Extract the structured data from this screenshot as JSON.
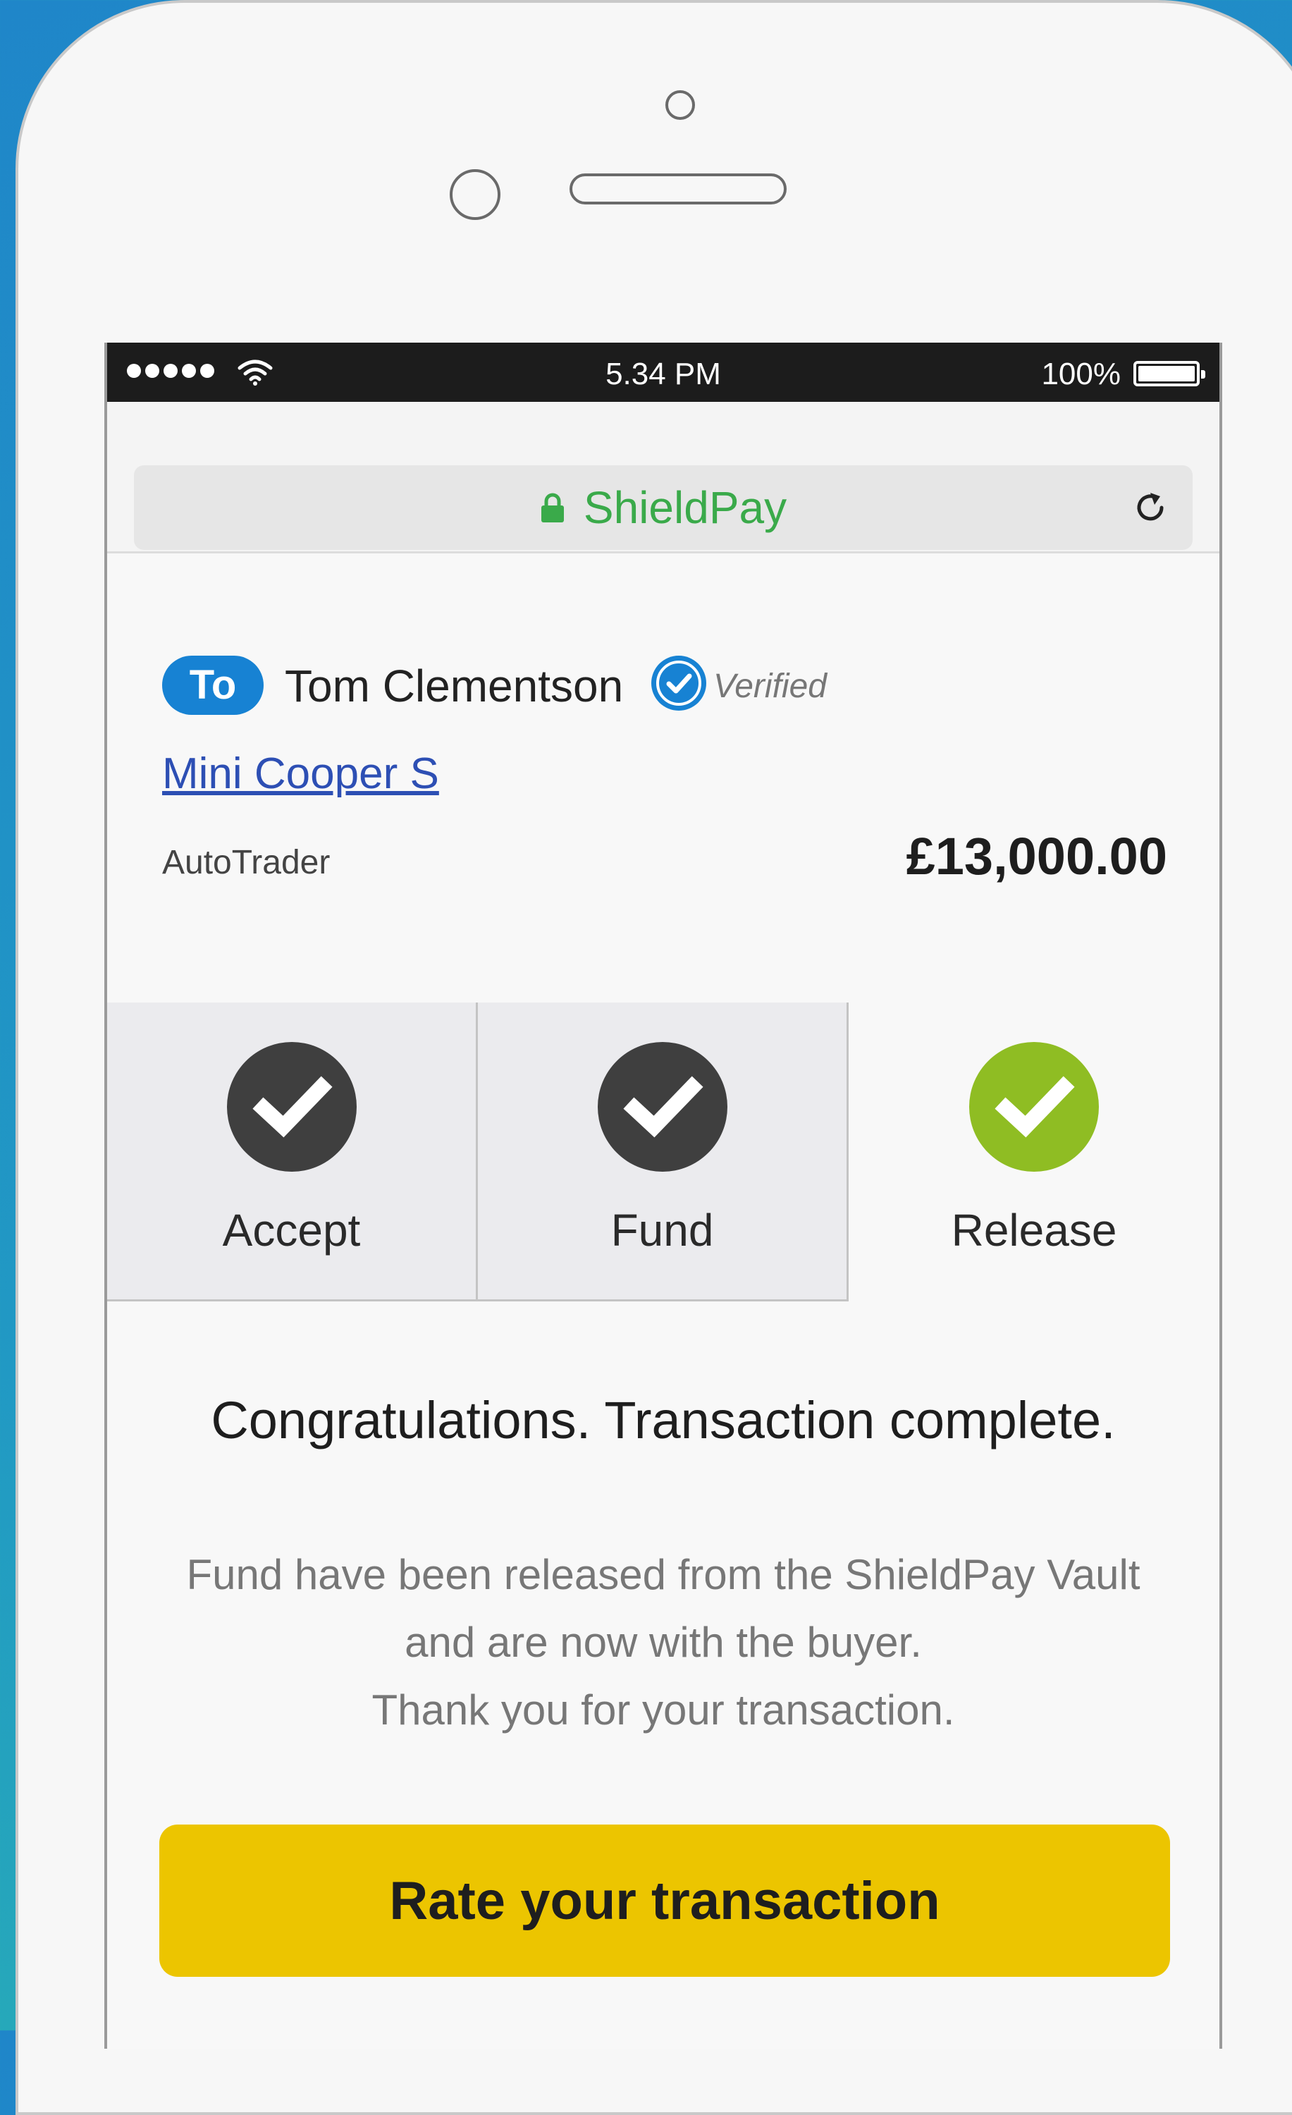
{
  "status_bar": {
    "time": "5.34 PM",
    "battery_percent": "100%",
    "signal_bars": 5,
    "battery_level": 1.0
  },
  "browser": {
    "url_text": "ShieldPay",
    "lock_icon": "lock-icon",
    "reload_icon": "reload-icon"
  },
  "transaction": {
    "to_label": "To",
    "recipient_name": "Tom Clementson",
    "verified_label": "Verified",
    "item_name": "Mini Cooper S",
    "source": "AutoTrader",
    "amount": "£13,000.00"
  },
  "steps": [
    {
      "label": "Accept",
      "state": "done",
      "color": "#3f3f3f"
    },
    {
      "label": "Fund",
      "state": "done",
      "color": "#3f3f3f"
    },
    {
      "label": "Release",
      "state": "active",
      "color": "#8fbd23"
    }
  ],
  "message": {
    "title": "Congratulations. Transaction complete.",
    "lines": [
      "Fund have been released from the ShieldPay Vault",
      "and are now with the buyer.",
      "Thank you for your transaction."
    ]
  },
  "cta": {
    "label": "Rate your transaction"
  },
  "colors": {
    "accent_blue": "#1782d3",
    "success_green": "#8fbd23",
    "brand_green": "#3aaa4a",
    "button_yellow": "#ecc500"
  }
}
